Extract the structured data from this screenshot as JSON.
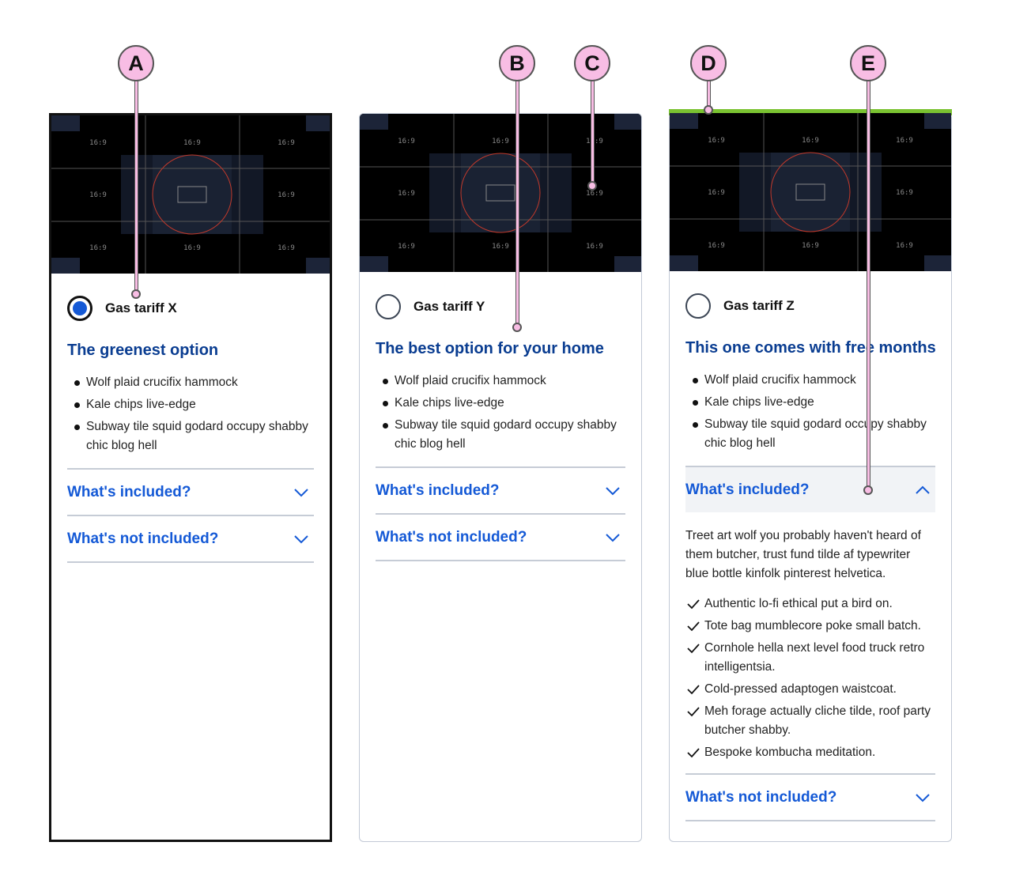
{
  "colors": {
    "accent": "#1459d6",
    "heading": "#0a3d91",
    "highlight_bar": "#7ac231",
    "callout": "#f8bde4"
  },
  "media_placeholder": {
    "label": "16:9"
  },
  "callouts": [
    "A",
    "B",
    "C",
    "D",
    "E"
  ],
  "cards": [
    {
      "radio_label": "Gas tariff X",
      "selected": true,
      "heading": "The greenest option",
      "bullets": [
        "Wolf plaid crucifix hammock",
        "Kale chips live-edge",
        "Subway tile squid godard occupy shabby chic blog hell"
      ],
      "accordions": [
        {
          "label": "What's included?",
          "icon": "chevron-down-icon"
        },
        {
          "label": "What's not included?",
          "icon": "chevron-down-icon"
        }
      ]
    },
    {
      "radio_label": "Gas tariff Y",
      "selected": false,
      "heading": "The best option for your home",
      "bullets": [
        "Wolf plaid crucifix hammock",
        "Kale chips live-edge",
        "Subway tile squid godard occupy shabby chic blog hell"
      ],
      "accordions": [
        {
          "label": "What's included?",
          "icon": "chevron-down-icon"
        },
        {
          "label": "What's not included?",
          "icon": "chevron-down-icon"
        }
      ]
    },
    {
      "radio_label": "Gas tariff Z",
      "selected": false,
      "heading": "This one comes with free months",
      "bullets": [
        "Wolf plaid crucifix hammock",
        "Kale chips live-edge",
        "Subway tile squid godard occupy shabby chic blog hell"
      ],
      "accordions": [
        {
          "label": "What's included?",
          "icon": "chevron-up-icon",
          "expanded": true,
          "body": "Treet art wolf you probably haven't heard of them butcher, trust fund tilde af typewriter blue bottle kinfolk pinterest helvetica.",
          "checks": [
            "Authentic lo-fi ethical put a bird on.",
            "Tote bag mumblecore poke small batch.",
            "Cornhole hella next level food truck retro intelligentsia.",
            "Cold-pressed adaptogen waistcoat.",
            "Meh forage actually cliche tilde, roof party butcher shabby.",
            "Bespoke kombucha meditation."
          ]
        },
        {
          "label": "What's not included?",
          "icon": "chevron-down-icon"
        }
      ]
    }
  ]
}
